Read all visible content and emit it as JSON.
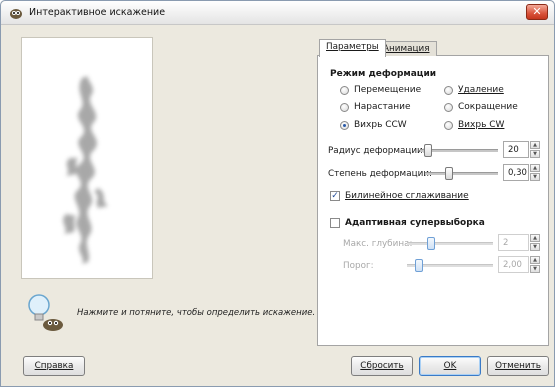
{
  "window": {
    "title": "Интерактивное искажение",
    "close_glyph": "✕"
  },
  "hint": {
    "text": "Нажмите и потяните, чтобы определить искажение."
  },
  "tabs": [
    {
      "label": "Параметры",
      "active": true
    },
    {
      "label": "Анимация",
      "active": false
    }
  ],
  "deform": {
    "title": "Режим деформации",
    "modes": [
      {
        "label": "Перемещение",
        "selected": false
      },
      {
        "label": "Удаление",
        "selected": false
      },
      {
        "label": "Нарастание",
        "selected": false
      },
      {
        "label": "Сокращение",
        "selected": false
      },
      {
        "label": "Вихрь CCW",
        "selected": true
      },
      {
        "label": "Вихрь CW",
        "selected": false
      }
    ]
  },
  "radius": {
    "label": "Радиус деформации:",
    "value": "20",
    "level": 0.05
  },
  "strength": {
    "label": "Степень деформации:",
    "value": "0,30",
    "level": 0.3
  },
  "bilinear": {
    "label": "Билинейное сглаживание",
    "checked": true
  },
  "adaptive": {
    "label": "Адаптивная супервыборка",
    "checked": false,
    "depth": {
      "label": "Макс. глубина:",
      "value": "2",
      "level": 0.25
    },
    "threshold": {
      "label": "Порог:",
      "value": "2,00",
      "level": 0.1
    }
  },
  "buttons": {
    "help": "Справка",
    "reset": "Сбросить",
    "ok": "OK",
    "cancel": "Отменить"
  },
  "icons": {
    "title_icon": "gimp-icon",
    "hint_icon": "lightbulb-icon",
    "spin_up": "▲",
    "spin_down": "▼",
    "check": "✓"
  },
  "colors": {
    "accent": "#3a7ac6",
    "close": "#d9533b"
  }
}
